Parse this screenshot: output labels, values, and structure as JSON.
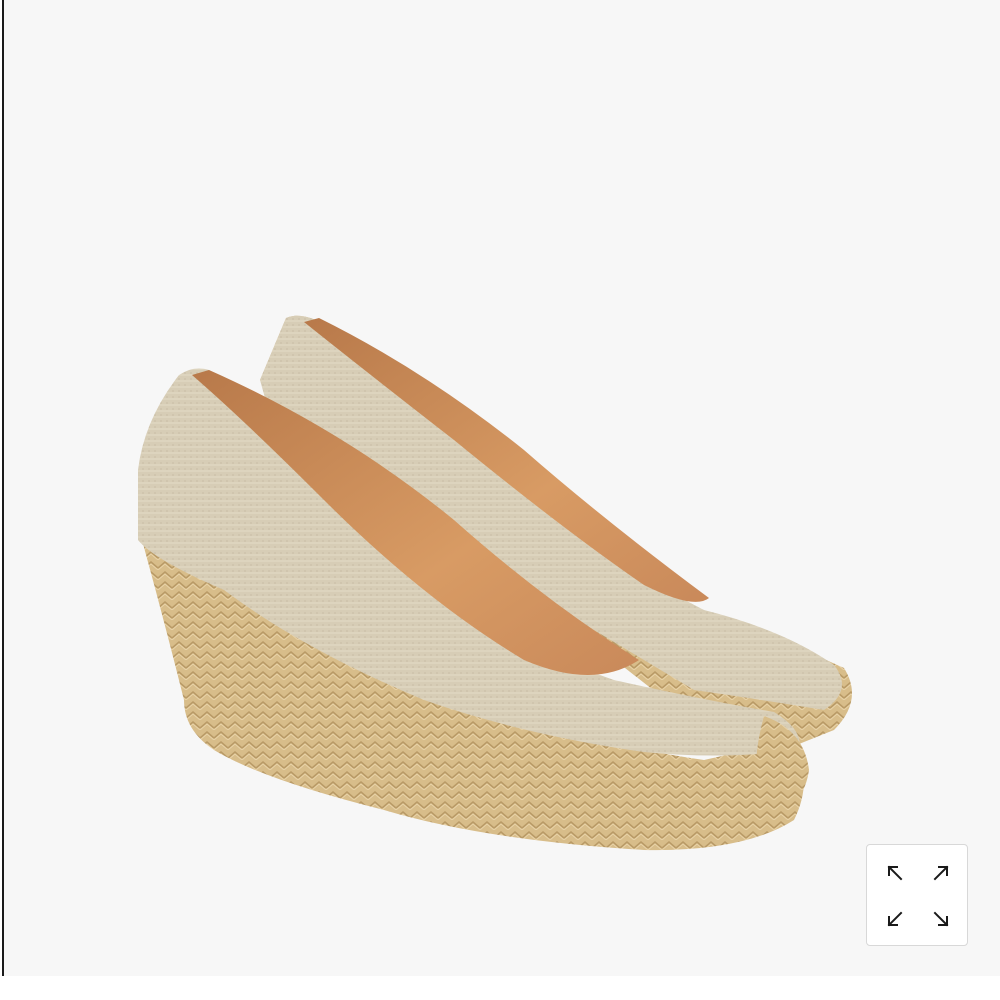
{
  "product_image": {
    "subject": "espadrille-wedge-pumps",
    "background_color": "#f7f7f7",
    "canvas_color": "#d9ccb1",
    "lining_color": "#c98a52",
    "jute_color": "#d8bd8a"
  },
  "controls": {
    "expand_icon": "expand-arrows-icon"
  }
}
